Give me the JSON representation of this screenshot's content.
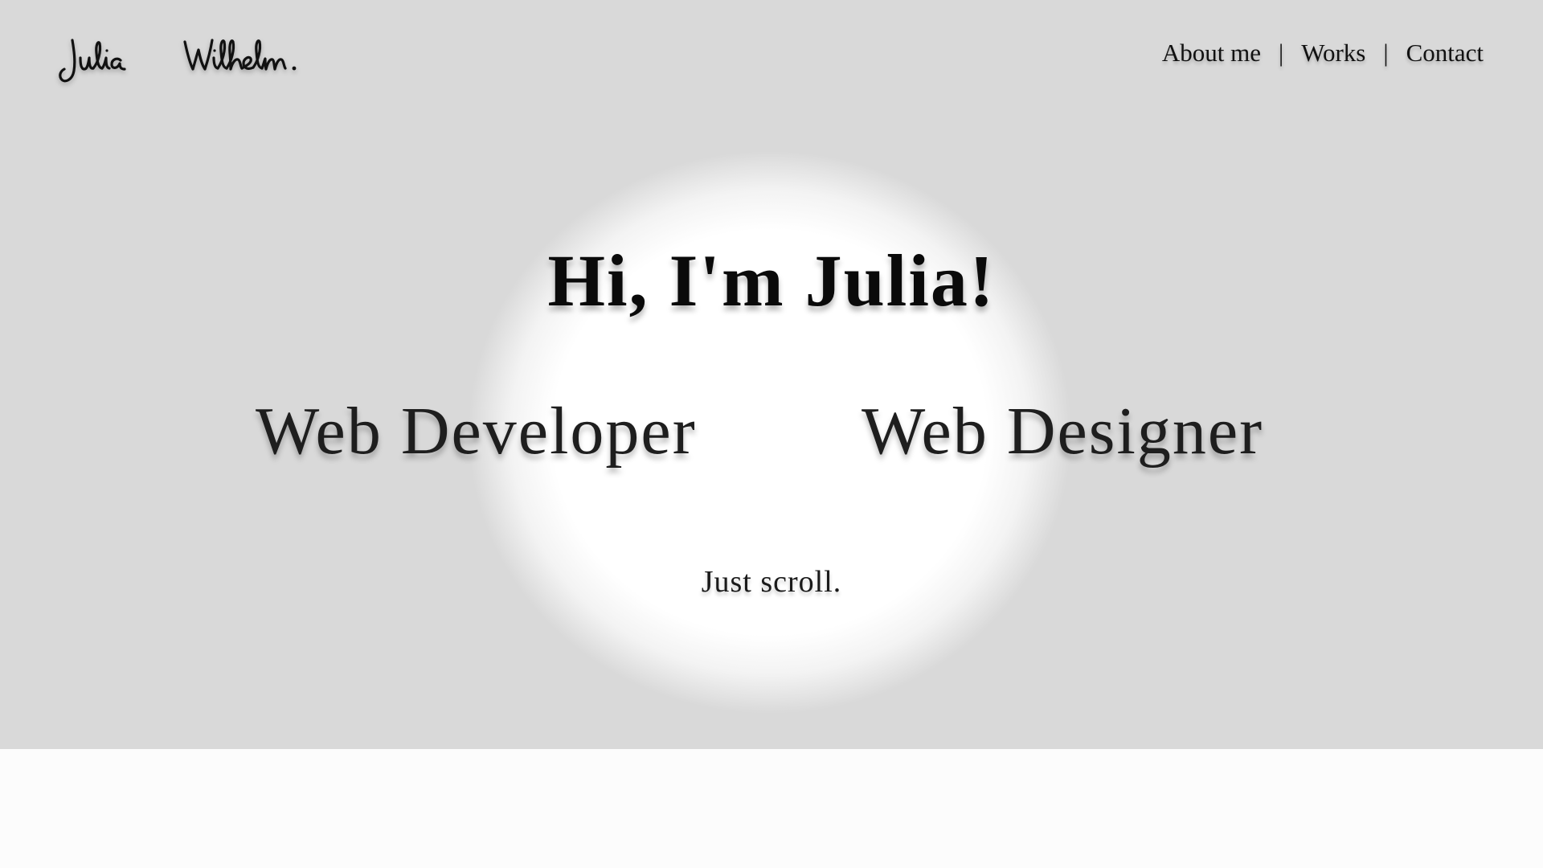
{
  "header": {
    "logo_text": "Julia Wilhelm.",
    "nav": [
      {
        "label": "About me"
      },
      {
        "label": "Works"
      },
      {
        "label": "Contact"
      }
    ],
    "separator": "|"
  },
  "hero": {
    "greeting": "Hi, I'm Julia!",
    "roles": [
      "Web Developer",
      "Web Designer"
    ],
    "scroll_hint": "Just scroll."
  },
  "colors": {
    "hero_background": "#d9d9d9",
    "spotlight": "#ffffff",
    "page_background": "#fcfcfc",
    "text": "#111111"
  }
}
